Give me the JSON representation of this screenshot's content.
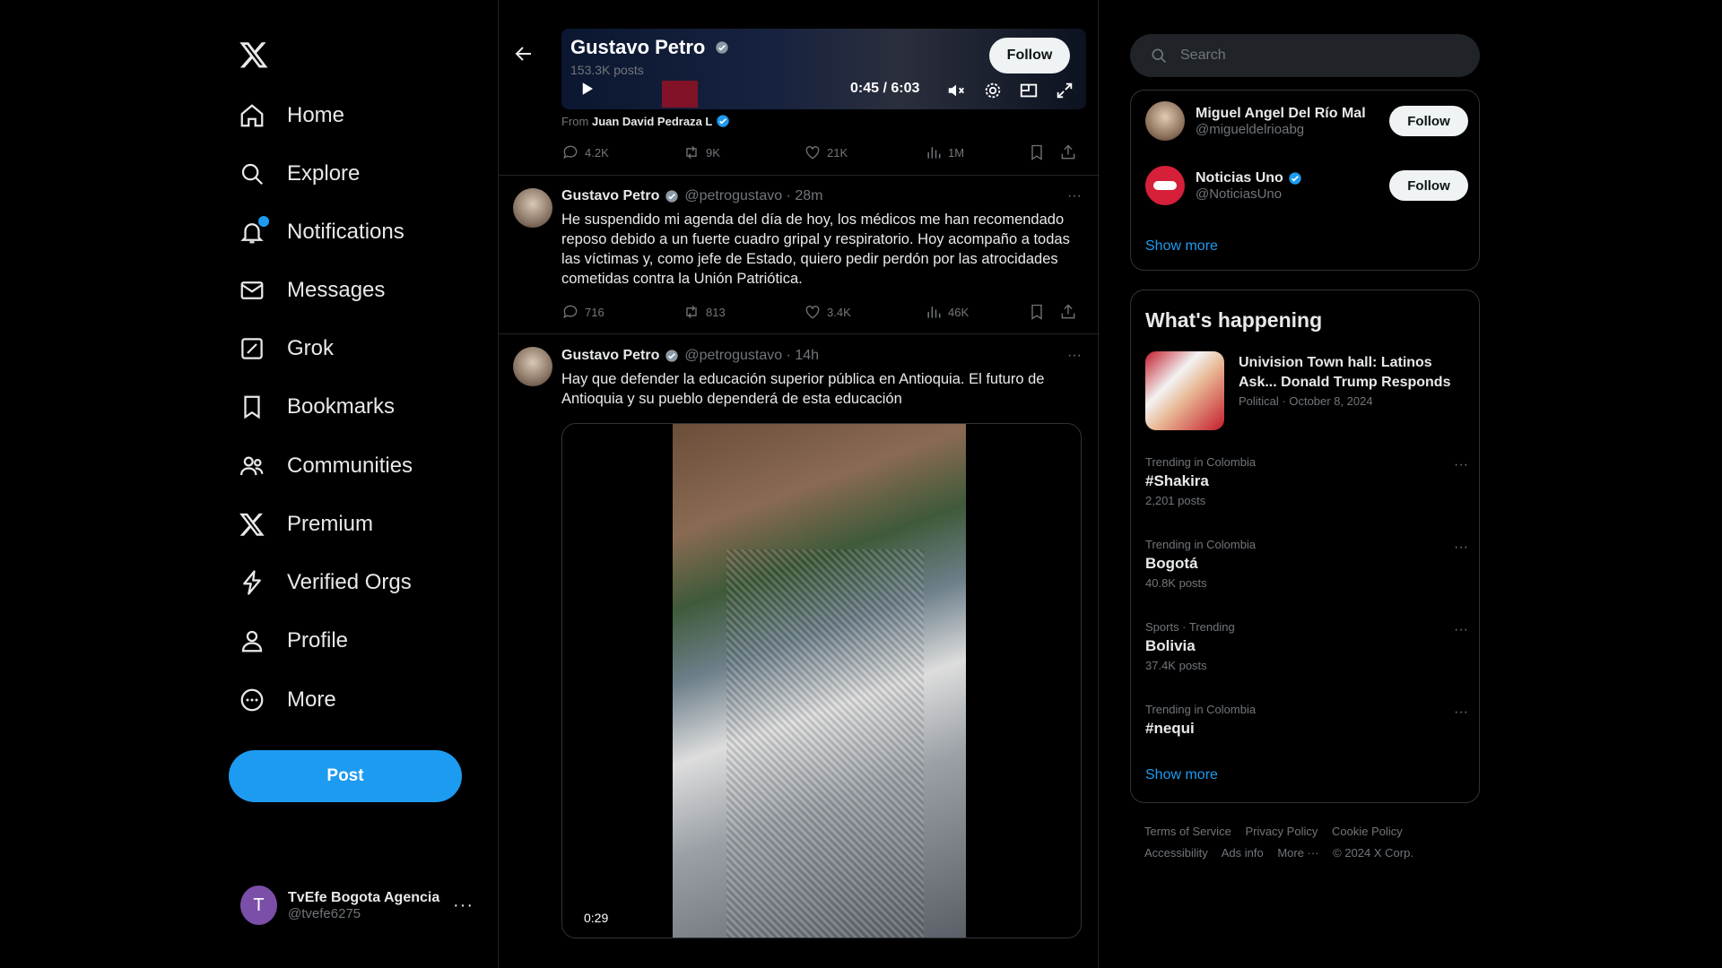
{
  "nav": {
    "items": [
      {
        "label": "Home",
        "icon": "home-icon"
      },
      {
        "label": "Explore",
        "icon": "search-icon"
      },
      {
        "label": "Notifications",
        "icon": "bell-icon"
      },
      {
        "label": "Messages",
        "icon": "mail-icon"
      },
      {
        "label": "Grok",
        "icon": "grok-icon"
      },
      {
        "label": "Bookmarks",
        "icon": "bookmark-icon"
      },
      {
        "label": "Communities",
        "icon": "communities-icon"
      },
      {
        "label": "Premium",
        "icon": "x-icon"
      },
      {
        "label": "Verified Orgs",
        "icon": "lightning-icon"
      },
      {
        "label": "Profile",
        "icon": "person-icon"
      },
      {
        "label": "More",
        "icon": "more-circle-icon"
      }
    ],
    "post_label": "Post",
    "account": {
      "initial": "T",
      "name": "TvEfe Bogota Agencia",
      "handle": "@tvefe6275",
      "more": "···"
    }
  },
  "player": {
    "title": "Gustavo Petro",
    "posts": "153.3K posts",
    "follow": "Follow",
    "time": "0:45 / 6:03",
    "from_prefix": "From",
    "from_name": "Juan David Pedraza L"
  },
  "tweets": [
    {
      "actions": {
        "reply": "4.2K",
        "retweet": "9K",
        "like": "21K",
        "views": "1M"
      }
    },
    {
      "name": "Gustavo Petro",
      "meta": "@petrogustavo · 28m",
      "text": "He suspendido mi agenda del día de hoy, los médicos me han recomendado reposo debido a un fuerte cuadro gripal y respiratorio. Hoy acompaño a todas las víctimas y, como jefe de Estado, quiero pedir perdón por las atrocidades cometidas contra la Unión Patriótica.",
      "actions": {
        "reply": "716",
        "retweet": "813",
        "like": "3.4K",
        "views": "46K"
      }
    },
    {
      "name": "Gustavo Petro",
      "meta": "@petrogustavo · 14h",
      "text": "Hay que defender la educación superior pública en Antioquia. El futuro de Antioquia y su pueblo dependerá de esta educación",
      "video_duration": "0:29"
    }
  ],
  "right": {
    "search_placeholder": "Search",
    "who_to_follow": [
      {
        "name": "Miguel Angel Del Río Mal",
        "handle": "@migueldelrioabg",
        "follow": "Follow",
        "avatar_color": "#a08870"
      },
      {
        "name": "Noticias Uno",
        "handle": "@NoticiasUno",
        "follow": "Follow",
        "avatar_color": "#d6203a"
      }
    ],
    "show_more": "Show more",
    "whats_happening": "What's happening",
    "news": {
      "title": "Univision Town hall: Latinos Ask... Donald Trump Responds",
      "meta": "Political · October 8, 2024"
    },
    "trends": [
      {
        "context": "Trending in Colombia",
        "topic": "#Shakira",
        "count": "2,201 posts"
      },
      {
        "context": "Trending in Colombia",
        "topic": "Bogotá",
        "count": "40.8K posts"
      },
      {
        "context": "Sports · Trending",
        "topic": "Bolivia",
        "count": "37.4K posts"
      },
      {
        "context": "Trending in Colombia",
        "topic": "#nequi",
        "count": ""
      }
    ],
    "show_more2": "Show more",
    "footer": {
      "terms": "Terms of Service",
      "privacy": "Privacy Policy",
      "cookie": "Cookie Policy",
      "accessibility": "Accessibility",
      "ads": "Ads info",
      "more": "More ···",
      "copyright": "© 2024 X Corp."
    }
  },
  "colors": {
    "accent": "#1d9bf0",
    "background": "#000000",
    "muted": "#71767b"
  }
}
